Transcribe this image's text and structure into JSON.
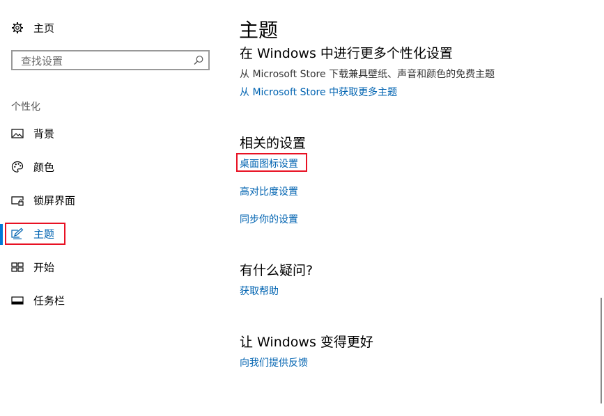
{
  "sidebar": {
    "home_label": "主页",
    "search_placeholder": "查找设置",
    "section_title": "个性化",
    "items": [
      {
        "label": "背景",
        "icon": "image-icon"
      },
      {
        "label": "颜色",
        "icon": "palette-icon"
      },
      {
        "label": "锁屏界面",
        "icon": "lockscreen-icon"
      },
      {
        "label": "主题",
        "icon": "theme-brush-icon",
        "selected": true
      },
      {
        "label": "开始",
        "icon": "start-grid-icon"
      },
      {
        "label": "任务栏",
        "icon": "taskbar-icon"
      }
    ]
  },
  "main": {
    "title": "主题",
    "more_section": {
      "heading": "在 Windows 中进行更多个性化设置",
      "description": "从 Microsoft Store 下载兼具壁纸、声音和颜色的免费主题",
      "link": "从 Microsoft Store 中获取更多主题"
    },
    "related_section": {
      "heading": "相关的设置",
      "links": [
        "桌面图标设置",
        "高对比度设置",
        "同步你的设置"
      ]
    },
    "question_section": {
      "heading": "有什么疑问?",
      "link": "获取帮助"
    },
    "feedback_section": {
      "heading": "让 Windows 变得更好",
      "link": "向我们提供反馈"
    }
  },
  "colors": {
    "accent": "#0078d7",
    "link": "#0063b1",
    "highlight_box": "#e81123"
  }
}
